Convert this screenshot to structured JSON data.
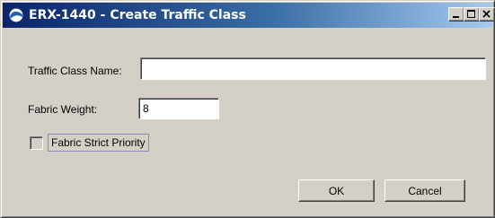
{
  "window": {
    "title": "ERX-1440 - Create Traffic Class",
    "app_icon": "globe-icon",
    "controls": [
      "minimize-icon",
      "maximize-icon",
      "close-icon"
    ]
  },
  "form": {
    "traffic_class_name": {
      "label": "Traffic Class Name:",
      "value": ""
    },
    "fabric_weight": {
      "label": "Fabric Weight:",
      "value": "8"
    },
    "fabric_strict_priority": {
      "label": "Fabric Strict Priority",
      "checked": false
    }
  },
  "buttons": {
    "ok_label": "OK",
    "cancel_label": "Cancel"
  },
  "colors": {
    "titlebar_start": "#0a246a",
    "titlebar_end": "#a6caf0",
    "dialog_face": "#d4d0c8"
  }
}
